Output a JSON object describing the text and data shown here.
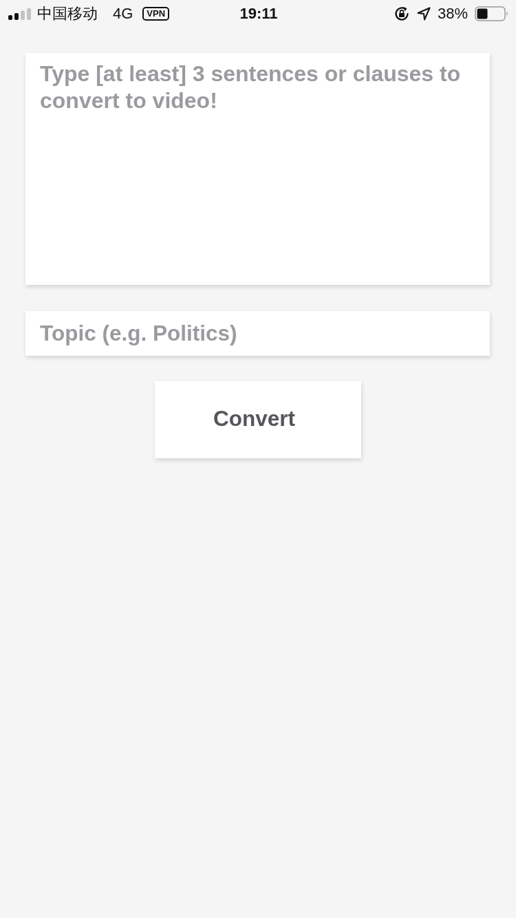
{
  "status_bar": {
    "carrier": "中国移动",
    "network": "4G",
    "vpn": "VPN",
    "time": "19:11",
    "battery": "38%"
  },
  "form": {
    "sentences": {
      "placeholder": "Type [at least] 3 sentences or clauses to convert to video!"
    },
    "topic": {
      "placeholder": "Topic (e.g. Politics)"
    },
    "submit": {
      "label": "Convert"
    }
  }
}
